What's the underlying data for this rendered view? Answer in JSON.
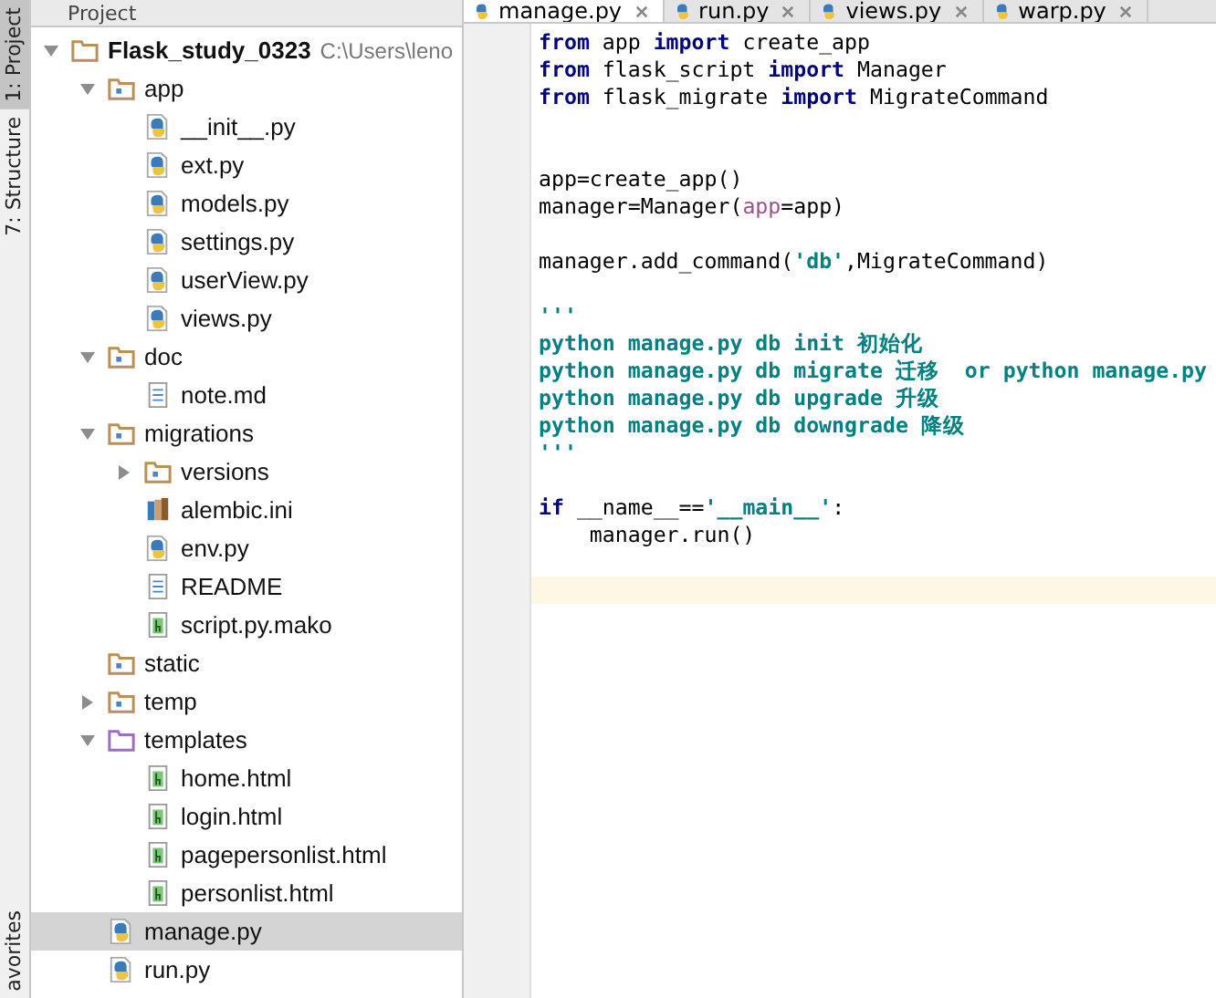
{
  "side_strip": [
    {
      "label": "1: Project",
      "selected": true
    },
    {
      "label": "7: Structure",
      "selected": false
    },
    {
      "label": "avorites",
      "selected": false
    }
  ],
  "project_panel": {
    "title": "Project",
    "tree": [
      {
        "name": "Flask_study_0323",
        "path": "C:\\Users\\leno",
        "kind": "root",
        "expanded": true,
        "selected": false,
        "children": [
          {
            "name": "app",
            "kind": "folder",
            "expanded": true,
            "selected": false,
            "children": [
              {
                "name": "__init__.py",
                "kind": "py",
                "selected": false
              },
              {
                "name": "ext.py",
                "kind": "py",
                "selected": false
              },
              {
                "name": "models.py",
                "kind": "py",
                "selected": false
              },
              {
                "name": "settings.py",
                "kind": "py",
                "selected": false
              },
              {
                "name": "userView.py",
                "kind": "py",
                "selected": false
              },
              {
                "name": "views.py",
                "kind": "py",
                "selected": false
              }
            ]
          },
          {
            "name": "doc",
            "kind": "folder",
            "expanded": true,
            "selected": false,
            "children": [
              {
                "name": "note.md",
                "kind": "text",
                "selected": false
              }
            ]
          },
          {
            "name": "migrations",
            "kind": "folder",
            "expanded": true,
            "selected": false,
            "children": [
              {
                "name": "versions",
                "kind": "folder",
                "expanded": false,
                "selected": false
              },
              {
                "name": "alembic.ini",
                "kind": "ini",
                "selected": false
              },
              {
                "name": "env.py",
                "kind": "py",
                "selected": false
              },
              {
                "name": "README",
                "kind": "text",
                "selected": false
              },
              {
                "name": "script.py.mako",
                "kind": "template",
                "selected": false
              }
            ]
          },
          {
            "name": "static",
            "kind": "folder",
            "selected": false
          },
          {
            "name": "temp",
            "kind": "folder",
            "expanded": false,
            "selected": false
          },
          {
            "name": "templates",
            "kind": "template_folder",
            "expanded": true,
            "selected": false,
            "children": [
              {
                "name": "home.html",
                "kind": "template",
                "selected": false
              },
              {
                "name": "login.html",
                "kind": "template",
                "selected": false
              },
              {
                "name": "pagepersonlist.html",
                "kind": "template",
                "selected": false
              },
              {
                "name": "personlist.html",
                "kind": "template",
                "selected": false
              }
            ]
          },
          {
            "name": "manage.py",
            "kind": "py",
            "selected": true
          },
          {
            "name": "run.py",
            "kind": "py",
            "selected": false
          }
        ]
      }
    ]
  },
  "editor": {
    "tabs": [
      {
        "label": "manage.py",
        "selected": true
      },
      {
        "label": "run.py",
        "selected": false
      },
      {
        "label": "views.py",
        "selected": false
      },
      {
        "label": "warp.py",
        "selected": false
      }
    ],
    "lines": [
      {
        "kind": "code",
        "current": false,
        "segments": [
          {
            "text": "from",
            "kind": "keyword"
          },
          {
            "text": " app ",
            "kind": "plain"
          },
          {
            "text": "import",
            "kind": "keyword"
          },
          {
            "text": " create_app",
            "kind": "plain"
          }
        ]
      },
      {
        "kind": "code",
        "current": false,
        "segments": [
          {
            "text": "from",
            "kind": "keyword"
          },
          {
            "text": " flask_script ",
            "kind": "plain"
          },
          {
            "text": "import",
            "kind": "keyword"
          },
          {
            "text": " Manager",
            "kind": "plain"
          }
        ]
      },
      {
        "kind": "code",
        "current": false,
        "segments": [
          {
            "text": "from",
            "kind": "keyword"
          },
          {
            "text": " flask_migrate ",
            "kind": "plain"
          },
          {
            "text": "import",
            "kind": "keyword"
          },
          {
            "text": " MigrateCommand",
            "kind": "plain"
          }
        ]
      },
      {
        "kind": "blank",
        "current": false
      },
      {
        "kind": "blank",
        "current": false
      },
      {
        "kind": "code",
        "current": false,
        "segments": [
          {
            "text": "app=create_app()",
            "kind": "plain"
          }
        ]
      },
      {
        "kind": "code",
        "current": false,
        "segments": [
          {
            "text": "manager=Manager(",
            "kind": "plain"
          },
          {
            "text": "app",
            "kind": "param"
          },
          {
            "text": "=app)",
            "kind": "plain"
          }
        ]
      },
      {
        "kind": "blank",
        "current": false
      },
      {
        "kind": "code",
        "current": false,
        "segments": [
          {
            "text": "manager.add_command(",
            "kind": "plain"
          },
          {
            "text": "'db'",
            "kind": "string"
          },
          {
            "text": ",MigrateCommand)",
            "kind": "plain"
          }
        ]
      },
      {
        "kind": "blank",
        "current": false
      },
      {
        "kind": "code",
        "current": false,
        "segments": [
          {
            "text": "'''",
            "kind": "docstring"
          }
        ]
      },
      {
        "kind": "code",
        "current": false,
        "segments": [
          {
            "text": "python manage.py db init 初始化",
            "kind": "docstring"
          }
        ]
      },
      {
        "kind": "code",
        "current": false,
        "segments": [
          {
            "text": "python manage.py db migrate 迁移  or python manage.py",
            "kind": "docstring"
          }
        ]
      },
      {
        "kind": "code",
        "current": false,
        "segments": [
          {
            "text": "python manage.py db upgrade 升级",
            "kind": "docstring"
          }
        ]
      },
      {
        "kind": "code",
        "current": false,
        "segments": [
          {
            "text": "python manage.py db downgrade 降级",
            "kind": "docstring"
          }
        ]
      },
      {
        "kind": "code",
        "current": false,
        "segments": [
          {
            "text": "'''",
            "kind": "docstring"
          }
        ]
      },
      {
        "kind": "blank",
        "current": false
      },
      {
        "kind": "code",
        "current": false,
        "segments": [
          {
            "text": "if",
            "kind": "keyword"
          },
          {
            "text": " __name__==",
            "kind": "plain"
          },
          {
            "text": "'__main__'",
            "kind": "string"
          },
          {
            "text": ":",
            "kind": "plain"
          }
        ]
      },
      {
        "kind": "code",
        "current": false,
        "segments": [
          {
            "text": "    manager.run()",
            "kind": "plain"
          }
        ]
      },
      {
        "kind": "blank",
        "current": false
      },
      {
        "kind": "blank",
        "current": true
      }
    ]
  }
}
